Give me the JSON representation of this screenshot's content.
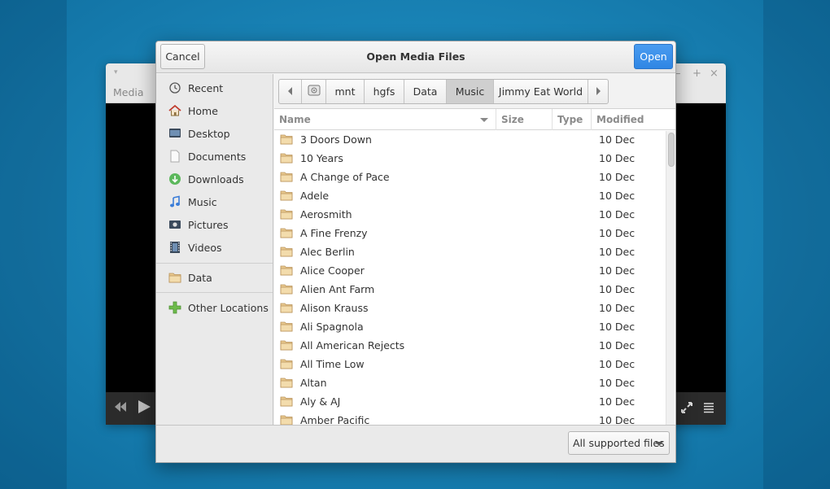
{
  "background_window": {
    "title": "Media"
  },
  "dialog": {
    "title": "Open Media Files",
    "cancel_label": "Cancel",
    "open_label": "Open",
    "filter_label": "All supported files"
  },
  "sidebar": {
    "items": [
      {
        "label": "Recent",
        "icon": "clock-icon"
      },
      {
        "label": "Home",
        "icon": "home-icon"
      },
      {
        "label": "Desktop",
        "icon": "desktop-icon"
      },
      {
        "label": "Documents",
        "icon": "document-icon"
      },
      {
        "label": "Downloads",
        "icon": "download-icon"
      },
      {
        "label": "Music",
        "icon": "music-note-icon"
      },
      {
        "label": "Pictures",
        "icon": "camera-icon"
      },
      {
        "label": "Videos",
        "icon": "film-icon"
      }
    ],
    "bookmarks": [
      {
        "label": "Data",
        "icon": "folder-icon"
      }
    ],
    "other": {
      "label": "Other Locations",
      "icon": "plus-icon"
    }
  },
  "pathbar": {
    "segments": [
      "mnt",
      "hgfs",
      "Data",
      "Music",
      "Jimmy Eat World"
    ],
    "active": "Music"
  },
  "columns": {
    "name": "Name",
    "size": "Size",
    "type": "Type",
    "modified": "Modified"
  },
  "files": [
    {
      "name": "3 Doors Down",
      "modified": "10 Dec"
    },
    {
      "name": "10 Years",
      "modified": "10 Dec"
    },
    {
      "name": "A Change of Pace",
      "modified": "10 Dec"
    },
    {
      "name": "Adele",
      "modified": "10 Dec"
    },
    {
      "name": "Aerosmith",
      "modified": "10 Dec"
    },
    {
      "name": "A Fine Frenzy",
      "modified": "10 Dec"
    },
    {
      "name": "Alec Berlin",
      "modified": "10 Dec"
    },
    {
      "name": "Alice Cooper",
      "modified": "10 Dec"
    },
    {
      "name": "Alien Ant Farm",
      "modified": "10 Dec"
    },
    {
      "name": "Alison Krauss",
      "modified": "10 Dec"
    },
    {
      "name": "Ali Spagnola",
      "modified": "10 Dec"
    },
    {
      "name": "All American Rejects",
      "modified": "10 Dec"
    },
    {
      "name": "All Time Low",
      "modified": "10 Dec"
    },
    {
      "name": "Altan",
      "modified": "10 Dec"
    },
    {
      "name": "Aly & AJ",
      "modified": "10 Dec"
    },
    {
      "name": "Amber Pacific",
      "modified": "10 Dec"
    }
  ],
  "colors": {
    "accent": "#3b91ea",
    "selected_path": "#cfcfcf"
  }
}
